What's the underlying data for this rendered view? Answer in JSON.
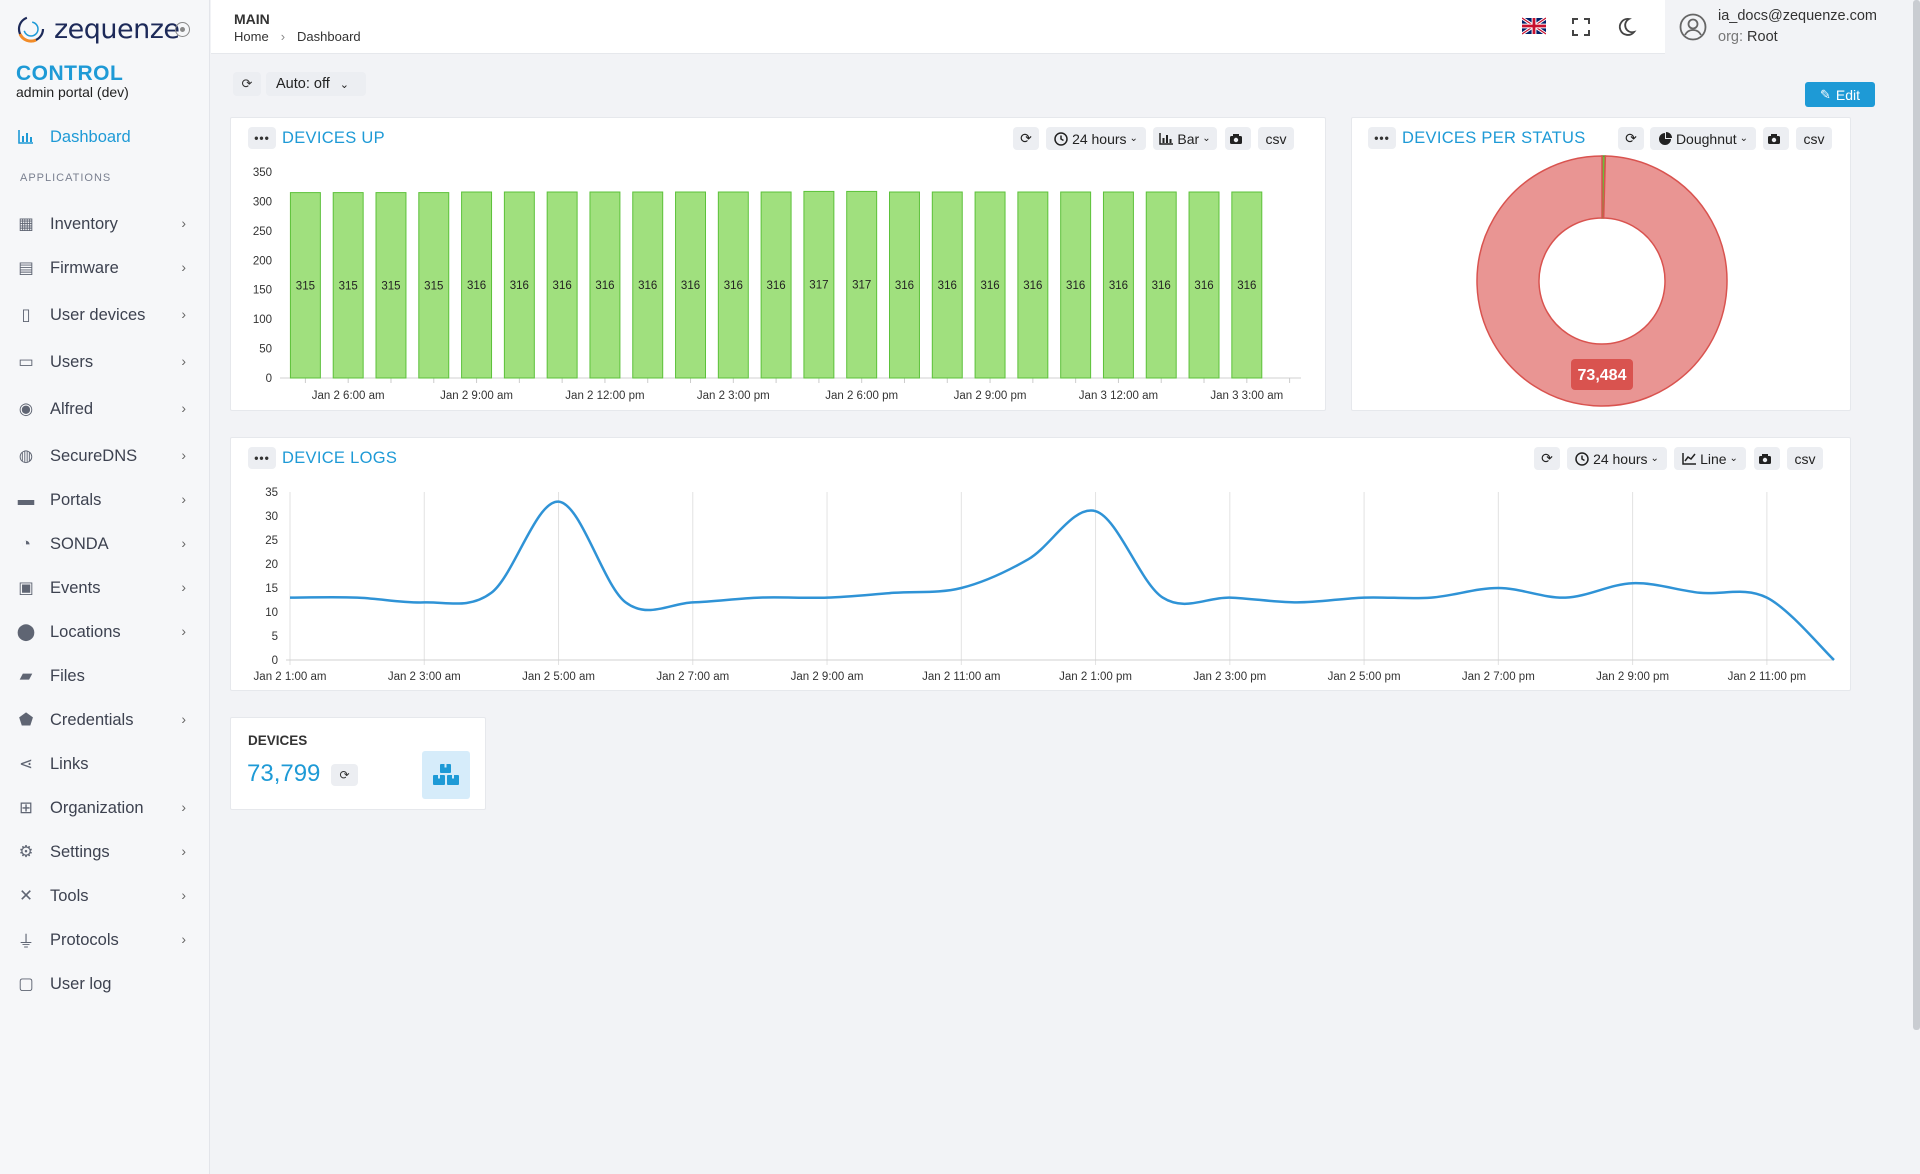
{
  "app": {
    "logo": "zequenze",
    "brand": "CONTROL",
    "subtitle": "admin portal (dev)"
  },
  "sidebar": {
    "dashboard": "Dashboard",
    "section": "APPLICATIONS",
    "items": [
      {
        "label": "Inventory",
        "icon": "boxes-icon",
        "chevron": true
      },
      {
        "label": "Firmware",
        "icon": "box-open-icon",
        "chevron": true
      },
      {
        "label": "User devices",
        "icon": "mobile-icon",
        "chevron": true
      },
      {
        "label": "Users",
        "icon": "id-card-icon",
        "chevron": true
      },
      {
        "label": "Alfred",
        "icon": "robot-icon",
        "chevron": true
      },
      {
        "label": "SecureDNS",
        "icon": "globe-icon",
        "chevron": true
      },
      {
        "label": "Portals",
        "icon": "window-icon",
        "chevron": true
      },
      {
        "label": "SONDA",
        "icon": "gauge-icon",
        "chevron": true
      },
      {
        "label": "Events",
        "icon": "event-icon",
        "chevron": true
      },
      {
        "label": "Locations",
        "icon": "map-pin-icon",
        "chevron": true
      },
      {
        "label": "Files",
        "icon": "folder-icon",
        "chevron": false
      },
      {
        "label": "Credentials",
        "icon": "shield-icon",
        "chevron": true
      },
      {
        "label": "Links",
        "icon": "share-icon",
        "chevron": false
      },
      {
        "label": "Organization",
        "icon": "sitemap-icon",
        "chevron": true
      },
      {
        "label": "Settings",
        "icon": "gears-icon",
        "chevron": true
      },
      {
        "label": "Tools",
        "icon": "tools-icon",
        "chevron": true
      },
      {
        "label": "Protocols",
        "icon": "plug-icon",
        "chevron": true
      },
      {
        "label": "User log",
        "icon": "calendar-icon",
        "chevron": false
      }
    ]
  },
  "header": {
    "section": "MAIN",
    "breadcrumb": [
      "Home",
      "Dashboard"
    ],
    "user_email": "ia_docs@zequenze.com",
    "org_label": "org:",
    "org_value": "Root"
  },
  "controls": {
    "auto_label": "Auto: off",
    "edit_label": "Edit"
  },
  "panels": {
    "devices_up": {
      "title": "DEVICES UP",
      "range": "24 hours",
      "type": "Bar",
      "csv": "csv"
    },
    "devices_per_status": {
      "title": "DEVICES PER STATUS",
      "type": "Doughnut",
      "csv": "csv"
    },
    "device_logs": {
      "title": "DEVICE LOGS",
      "range": "24 hours",
      "type": "Line",
      "csv": "csv"
    },
    "devices_stat": {
      "title": "DEVICES",
      "value": "73,799"
    }
  },
  "colors": {
    "accent": "#1e9ad6",
    "bar_fill": "#a0e07e",
    "bar_stroke": "#5cc13a",
    "donut_main": "#e99593",
    "donut_border": "#d9534f",
    "donut_small": "#6cbf3a",
    "line": "#2f93d6"
  },
  "chart_data": [
    {
      "type": "bar",
      "title": "DEVICES UP",
      "categories": [
        "Jan 2 5:00 am",
        "Jan 2 6:00 am",
        "Jan 2 7:00 am",
        "Jan 2 8:00 am",
        "Jan 2 9:00 am",
        "Jan 2 10:00 am",
        "Jan 2 11:00 am",
        "Jan 2 12:00 pm",
        "Jan 2 1:00 pm",
        "Jan 2 2:00 pm",
        "Jan 2 3:00 pm",
        "Jan 2 4:00 pm",
        "Jan 2 5:00 pm",
        "Jan 2 6:00 pm",
        "Jan 2 7:00 pm",
        "Jan 2 8:00 pm",
        "Jan 2 9:00 pm",
        "Jan 2 10:00 pm",
        "Jan 2 11:00 pm",
        "Jan 3 12:00 am",
        "Jan 3 1:00 am",
        "Jan 3 2:00 am",
        "Jan 3 3:00 am",
        "Jan 3 4:00 am"
      ],
      "values": [
        315,
        315,
        315,
        315,
        316,
        316,
        316,
        316,
        316,
        316,
        316,
        316,
        317,
        317,
        316,
        316,
        316,
        316,
        316,
        316,
        316,
        316,
        316,
        null
      ],
      "x_tick_labels": [
        "Jan 2 6:00 am",
        "Jan 2 9:00 am",
        "Jan 2 12:00 pm",
        "Jan 2 3:00 pm",
        "Jan 2 6:00 pm",
        "Jan 2 9:00 pm",
        "Jan 3 12:00 am",
        "Jan 3 3:00 am"
      ],
      "y_ticks": [
        0,
        50,
        100,
        150,
        200,
        250,
        300,
        350
      ],
      "ylim": [
        0,
        350
      ],
      "data_labels": true
    },
    {
      "type": "pie",
      "variant": "doughnut",
      "title": "DEVICES PER STATUS",
      "slices": [
        {
          "value": 73484,
          "label": "73,484",
          "color": "#e99593"
        },
        {
          "value": 315,
          "color": "#6cbf3a"
        }
      ]
    },
    {
      "type": "line",
      "title": "DEVICE LOGS",
      "x": [
        "Jan 2 1:00 am",
        "Jan 2 2:00 am",
        "Jan 2 3:00 am",
        "Jan 2 4:00 am",
        "Jan 2 5:00 am",
        "Jan 2 6:00 am",
        "Jan 2 7:00 am",
        "Jan 2 8:00 am",
        "Jan 2 9:00 am",
        "Jan 2 10:00 am",
        "Jan 2 11:00 am",
        "Jan 2 12:00 pm",
        "Jan 2 1:00 pm",
        "Jan 2 2:00 pm",
        "Jan 2 3:00 pm",
        "Jan 2 4:00 pm",
        "Jan 2 5:00 pm",
        "Jan 2 6:00 pm",
        "Jan 2 7:00 pm",
        "Jan 2 8:00 pm",
        "Jan 2 9:00 pm",
        "Jan 2 10:00 pm",
        "Jan 2 11:00 pm",
        "Jan 3 12:00 am"
      ],
      "values": [
        13,
        13,
        12,
        14,
        33,
        12,
        12,
        13,
        13,
        14,
        15,
        21,
        31,
        13,
        13,
        12,
        13,
        13,
        15,
        13,
        16,
        14,
        13,
        0
      ],
      "x_tick_labels": [
        "Jan 2 1:00 am",
        "Jan 2 3:00 am",
        "Jan 2 5:00 am",
        "Jan 2 7:00 am",
        "Jan 2 9:00 am",
        "Jan 2 11:00 am",
        "Jan 2 1:00 pm",
        "Jan 2 3:00 pm",
        "Jan 2 5:00 pm",
        "Jan 2 7:00 pm",
        "Jan 2 9:00 pm",
        "Jan 2 11:00 pm"
      ],
      "y_ticks": [
        0,
        5,
        10,
        15,
        20,
        25,
        30,
        35
      ],
      "ylim": [
        0,
        35
      ]
    }
  ]
}
